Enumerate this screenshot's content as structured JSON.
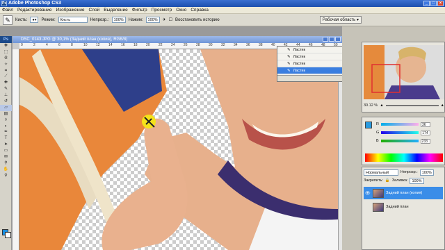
{
  "app": {
    "title": "Adobe Photoshop CS3"
  },
  "menu": [
    "Файл",
    "Редактирование",
    "Изображение",
    "Слой",
    "Выделение",
    "Фильтр",
    "Просмотр",
    "Окно",
    "Справка"
  ],
  "options": {
    "brush_label": "Кисть:",
    "mode_label": "Режим:",
    "mode_value": "Кисть",
    "opacity_label": "Непрозр.:",
    "opacity_value": "100%",
    "flow_label": "Нажим:",
    "flow_value": "100%",
    "restore_label": "Восстановить историю",
    "workspace_label": "Рабочая область"
  },
  "document": {
    "tab_title": "DSC_0143.JPG @ 30,1% (Задний план (копия), RGB/8)",
    "ruler_ticks": [
      "0",
      "2",
      "4",
      "6",
      "8",
      "10",
      "12",
      "14",
      "16",
      "18",
      "20",
      "22",
      "24",
      "26",
      "28",
      "30",
      "32",
      "34",
      "36",
      "38",
      "40",
      "42",
      "44",
      "46",
      "48",
      "50"
    ]
  },
  "history": {
    "items": [
      {
        "label": "Ластик"
      },
      {
        "label": "Ластик"
      },
      {
        "label": "Ластик"
      },
      {
        "label": "Ластик"
      }
    ]
  },
  "navigator": {
    "zoom": "30.12 %"
  },
  "color": {
    "channels": [
      {
        "name": "R",
        "value": "36"
      },
      {
        "name": "G",
        "value": "174"
      },
      {
        "name": "B",
        "value": "233"
      }
    ],
    "foreground": "#2a9be0"
  },
  "layers": {
    "blend_mode": "Нормальный",
    "opacity_label": "Непрозр.:",
    "opacity_value": "100%",
    "lock_label": "Закрепить:",
    "fill_label": "Заливка:",
    "fill_value": "100%",
    "items": [
      {
        "name": "Задний план (копия)"
      },
      {
        "name": "Задний план"
      }
    ]
  }
}
